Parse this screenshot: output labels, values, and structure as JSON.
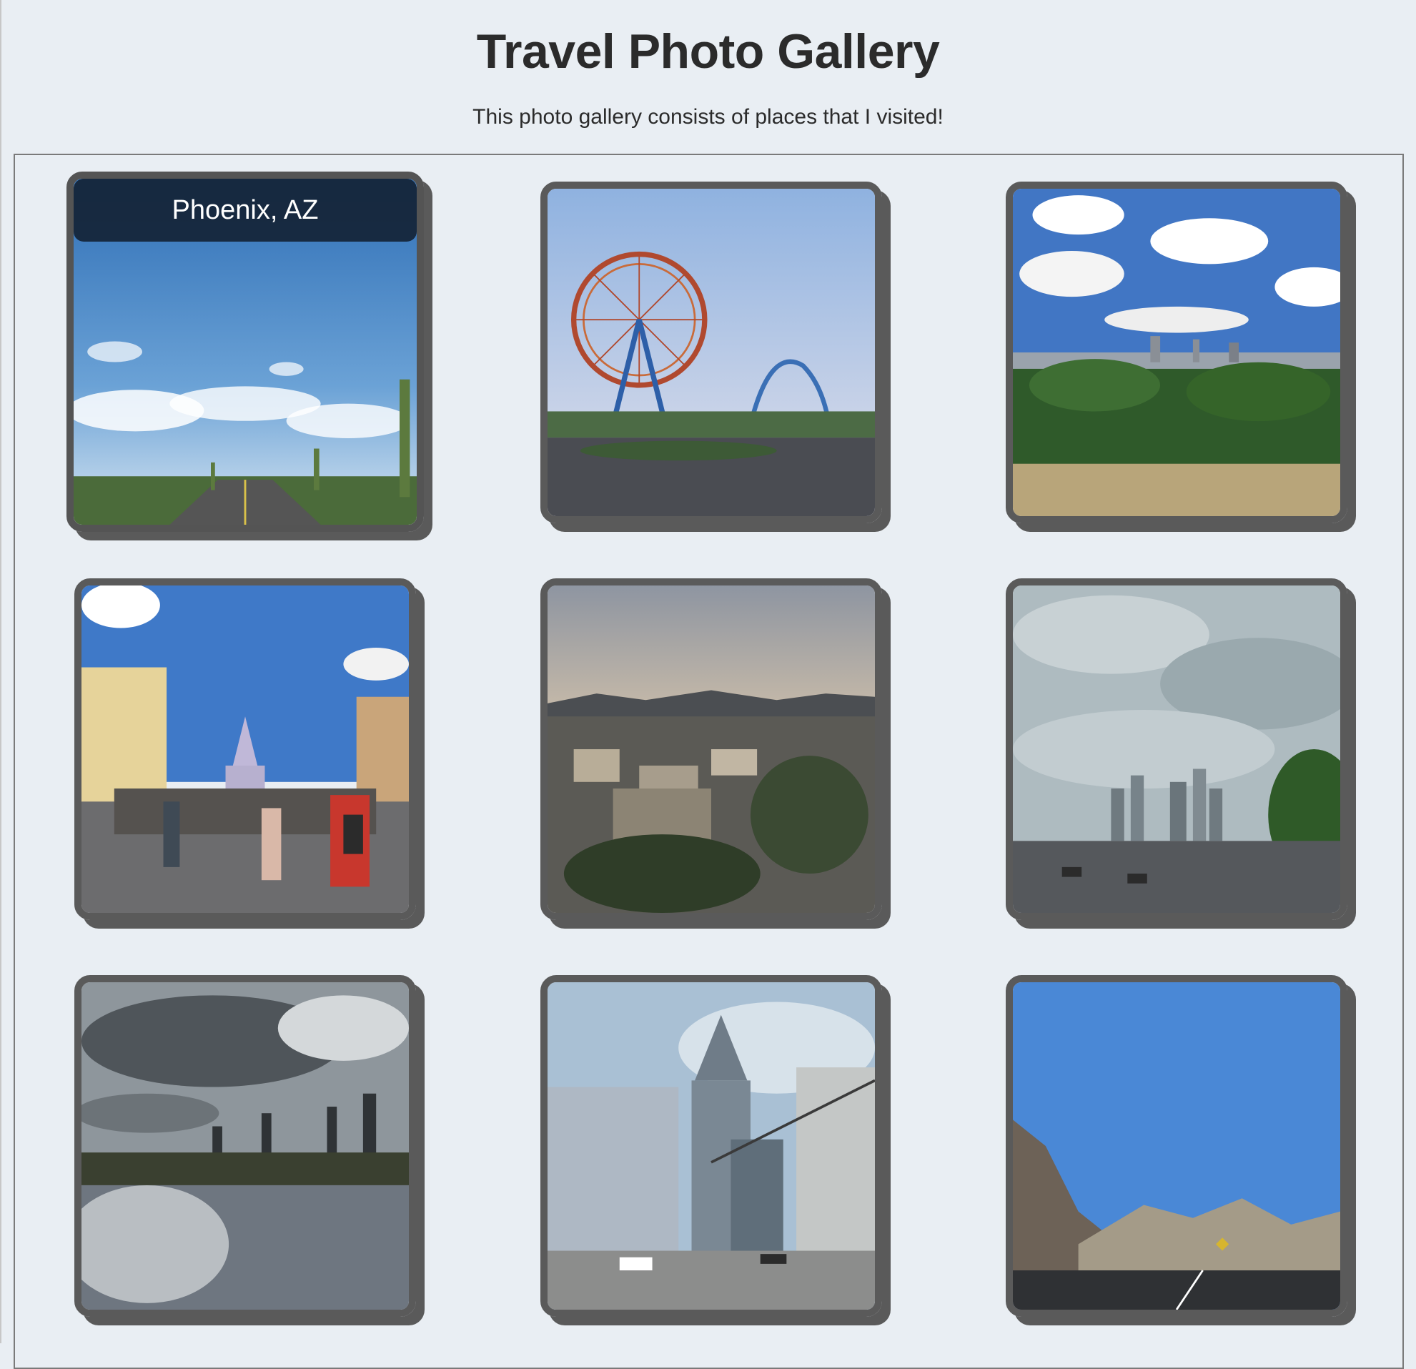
{
  "header": {
    "title": "Travel Photo Gallery",
    "subtitle": "This photo gallery consists of places that I visited!"
  },
  "gallery": {
    "photos": [
      {
        "id": "photo-1",
        "caption": "Phoenix, AZ",
        "caption_visible": true,
        "scene": "desert-road-saguaro"
      },
      {
        "id": "photo-2",
        "caption": "",
        "caption_visible": false,
        "scene": "amusement-park-ferris-wheel"
      },
      {
        "id": "photo-3",
        "caption": "",
        "caption_visible": false,
        "scene": "city-skyline-overlook"
      },
      {
        "id": "photo-4",
        "caption": "",
        "caption_visible": false,
        "scene": "theme-park-castle-main-street"
      },
      {
        "id": "photo-5",
        "caption": "",
        "caption_visible": false,
        "scene": "hillside-city-dusk"
      },
      {
        "id": "photo-6",
        "caption": "",
        "caption_visible": false,
        "scene": "cloudy-highway-skyline"
      },
      {
        "id": "photo-7",
        "caption": "",
        "caption_visible": false,
        "scene": "waterfall-city-skyline"
      },
      {
        "id": "photo-8",
        "caption": "",
        "caption_visible": false,
        "scene": "downtown-skyscrapers"
      },
      {
        "id": "photo-9",
        "caption": "",
        "caption_visible": false,
        "scene": "mountain-highway"
      }
    ]
  },
  "colors": {
    "background": "#e9eef3",
    "card_border": "#5a5a5a",
    "caption_bg": "#142337",
    "text": "#2b2b2b"
  }
}
